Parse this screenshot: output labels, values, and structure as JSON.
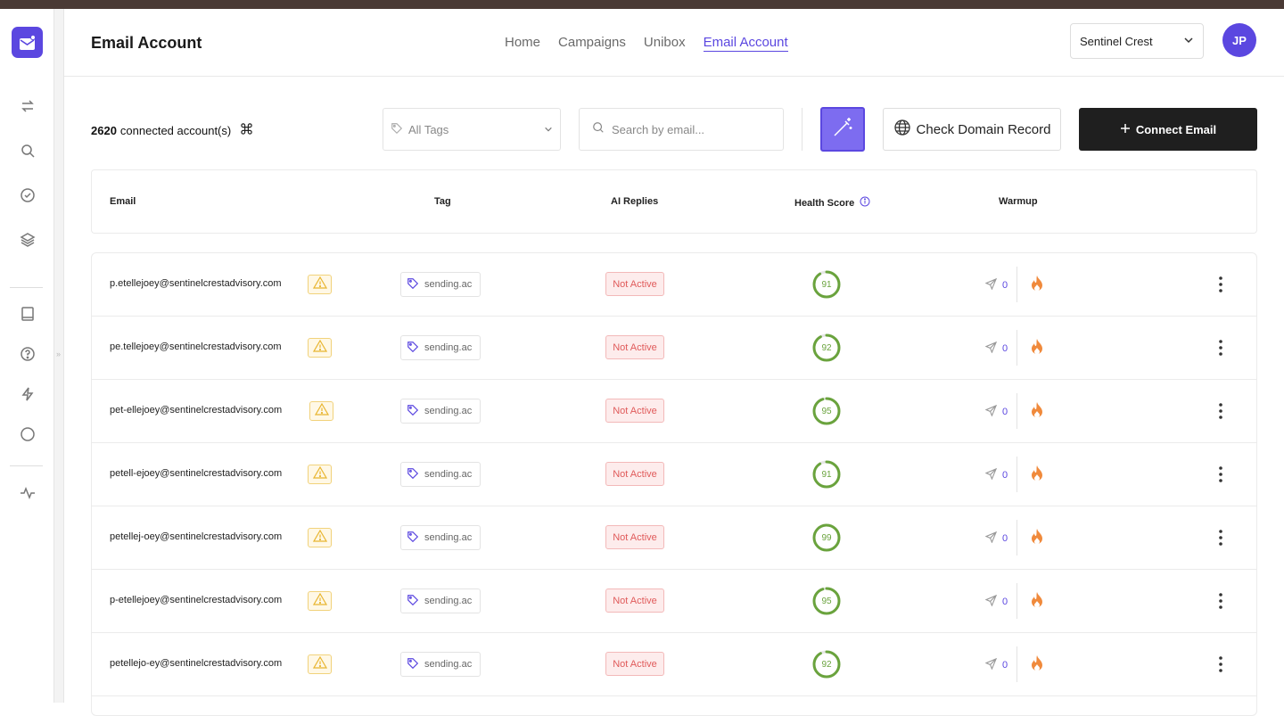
{
  "header": {
    "title": "Email Account",
    "nav": [
      {
        "label": "Home",
        "active": false
      },
      {
        "label": "Campaigns",
        "active": false
      },
      {
        "label": "Unibox",
        "active": false
      },
      {
        "label": "Email Account",
        "active": true
      }
    ],
    "workspace": "Sentinel Crest",
    "avatar_initials": "JP"
  },
  "toolbar": {
    "count": "2620",
    "count_suffix": "connected account(s)",
    "tags_placeholder": "All Tags",
    "search_placeholder": "Search by email...",
    "check_domain_label": "Check Domain Record",
    "connect_label": "Connect Email"
  },
  "table": {
    "columns": {
      "email": "Email",
      "tag": "Tag",
      "ai_replies": "AI Replies",
      "health": "Health Score",
      "warmup": "Warmup"
    },
    "rows": [
      {
        "email": "p.etellejoey@sentinelcrestadvisory.com",
        "tag": "sending.ac",
        "ai": "Not Active",
        "score": "91",
        "sent": "0"
      },
      {
        "email": "pe.tellejoey@sentinelcrestadvisory.com",
        "tag": "sending.ac",
        "ai": "Not Active",
        "score": "92",
        "sent": "0"
      },
      {
        "email": "pet-ellejoey@sentinelcrestadvisory.com",
        "tag": "sending.ac",
        "ai": "Not Active",
        "score": "95",
        "sent": "0"
      },
      {
        "email": "petell-ejoey@sentinelcrestadvisory.com",
        "tag": "sending.ac",
        "ai": "Not Active",
        "score": "91",
        "sent": "0"
      },
      {
        "email": "petellej-oey@sentinelcrestadvisory.com",
        "tag": "sending.ac",
        "ai": "Not Active",
        "score": "99",
        "sent": "0"
      },
      {
        "email": "p-etellejoey@sentinelcrestadvisory.com",
        "tag": "sending.ac",
        "ai": "Not Active",
        "score": "95",
        "sent": "0"
      },
      {
        "email": "petellejo-ey@sentinelcrestadvisory.com",
        "tag": "sending.ac",
        "ai": "Not Active",
        "score": "92",
        "sent": "0"
      }
    ]
  },
  "colors": {
    "accent": "#5b47e0",
    "score_green": "#6aa33d",
    "flame": "#f08a3c",
    "not_active_text": "#e05a5a"
  },
  "sidebar_icons": [
    "arrows-swap-icon",
    "search-icon",
    "check-circle-icon",
    "layers-icon",
    "book-icon",
    "help-circle-icon",
    "lightning-icon",
    "circle-icon",
    "activity-icon"
  ]
}
